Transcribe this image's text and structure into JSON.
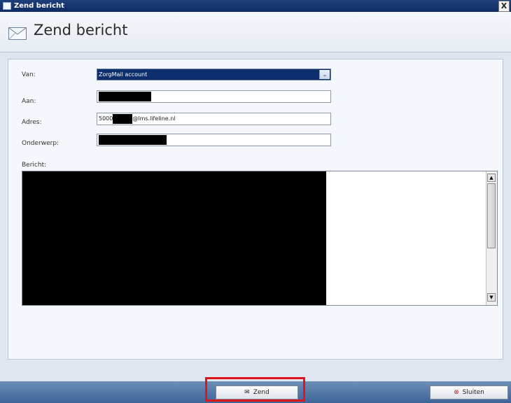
{
  "window": {
    "title": "Zend bericht",
    "close_glyph": "X"
  },
  "header": {
    "title": "Zend bericht",
    "icon": "envelope-icon"
  },
  "form": {
    "van_label": "Van:",
    "van_value": "ZorgMail account",
    "aan_label": "Aan:",
    "adres_label": "Adres:",
    "adres_prefix": "5000",
    "adres_suffix": "@lms.lifeline.nl",
    "onderwerp_label": "Onderwerp:",
    "bericht_label": "Bericht:"
  },
  "footer": {
    "send_label": "Zend",
    "close_label": "Sluiten"
  },
  "colors": {
    "highlight": "#e0141b",
    "title_bar": "#0f2c63",
    "footer": "#4f75a6"
  }
}
